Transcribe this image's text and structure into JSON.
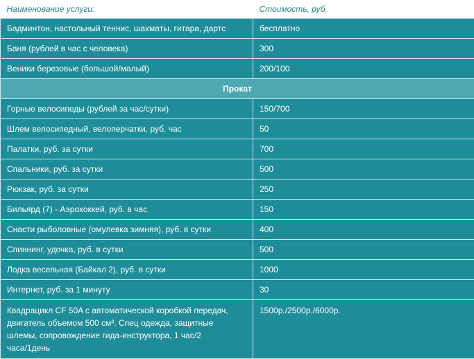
{
  "header": {
    "service_label": "Наименование  услуги:",
    "price_label": "Стоимость, руб."
  },
  "rows_top": [
    {
      "service": "Бадминтон, настольный теннис, шахматы, гитара, дартс",
      "price": "бесплатно"
    },
    {
      "service": "Баня (рублей в час с человека)",
      "price": "300"
    },
    {
      "service": "Веники березовые (большой/малый)",
      "price": "200/100"
    }
  ],
  "section_title": "Прокат",
  "rows_rental": [
    {
      "service": "Горные велосипеды (рублей за час/сутки)",
      "price": "150/700"
    },
    {
      "service": "Шлем велосипедный, велоперчатки, руб. час",
      "price": "50"
    },
    {
      "service": "Палатки, руб. за сутки",
      "price": "700"
    },
    {
      "service": "Спальники, руб. за сутки",
      "price": "500"
    },
    {
      "service": "Рюкзак, руб. за сутки",
      "price": "250"
    },
    {
      "service": "Бильярд (7) - Аэрохоккей, руб. в час",
      "price": "150"
    },
    {
      "service": "Снасти рыболовные (омулевка зимняя), руб. в сутки",
      "price": "400"
    },
    {
      "service": "Спиннинг, удочка, руб. в сутки",
      "price": "500"
    },
    {
      "service": "Лодка весельная (Байкал 2), руб. в сутки",
      "price": "1000"
    },
    {
      "service": "Интернет, руб. за 1 минуту",
      "price": "30"
    },
    {
      "service": "Квадрацикл  CF 50A с автоматической коробкой передач, двигатель объемом 500 см³. Спец одежда, защитные шлемы, сопровождение гида-инструктора, 1 час/2 часа/1день",
      "price": "1500р./2500р./6000р."
    }
  ]
}
